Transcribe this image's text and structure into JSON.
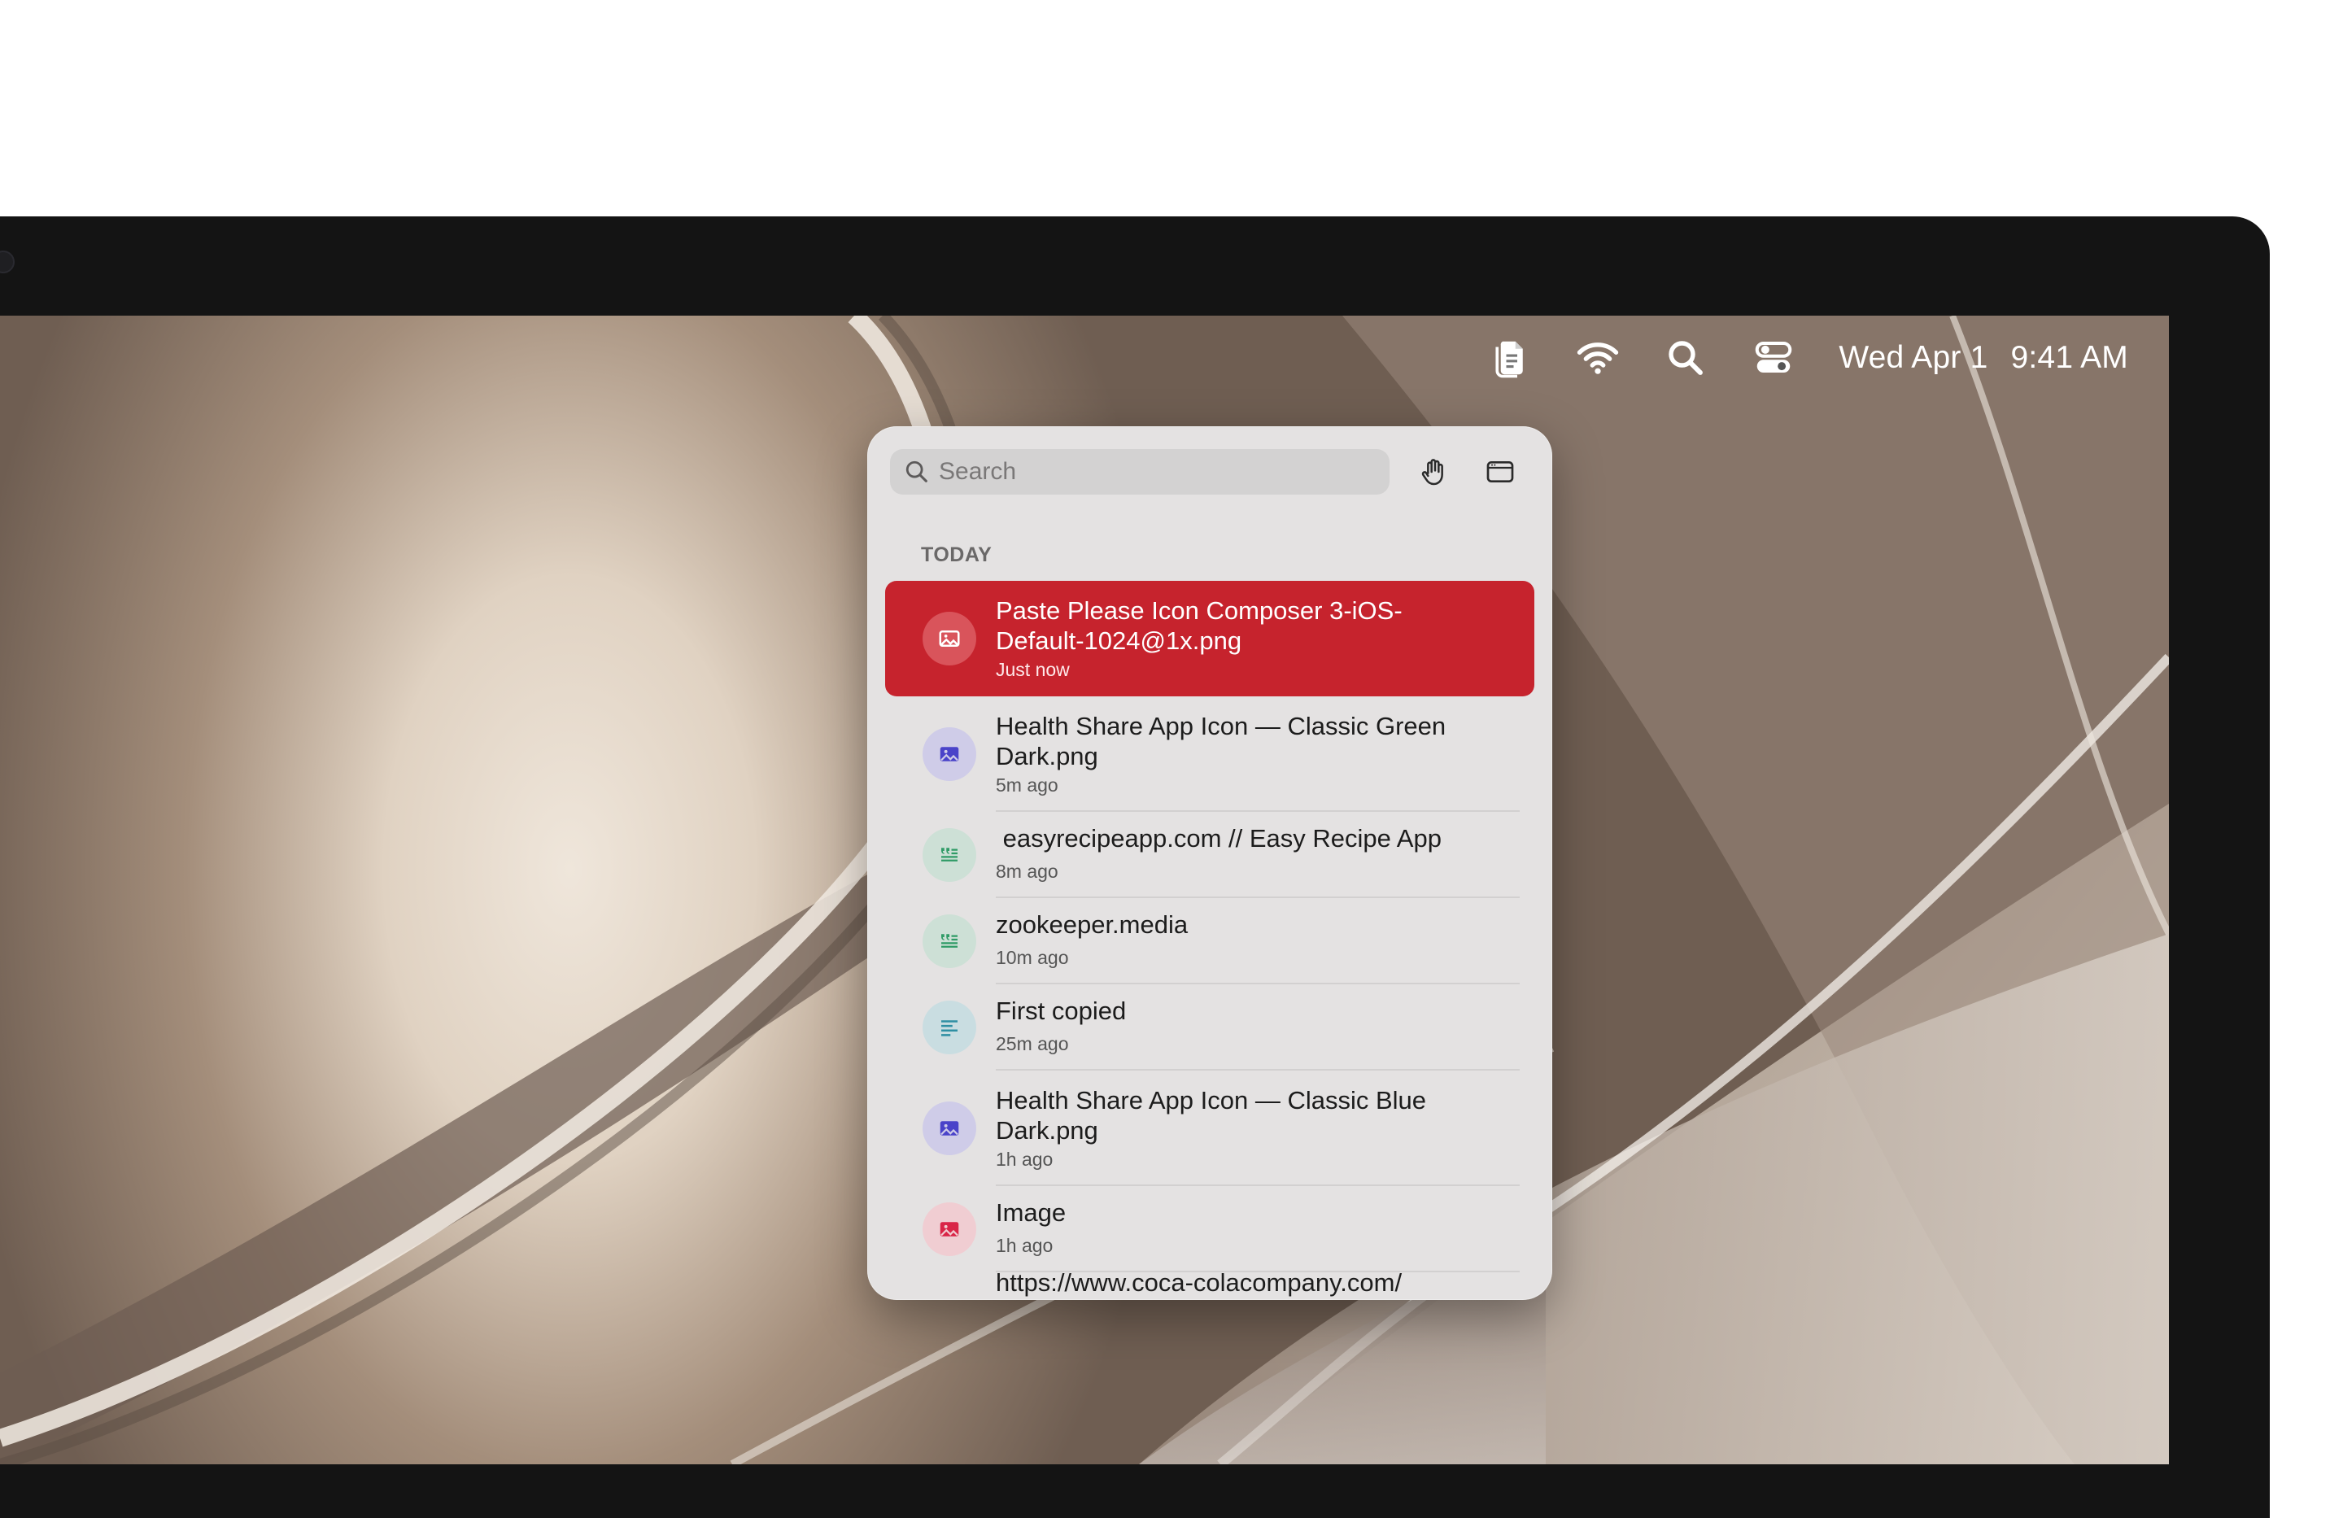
{
  "menubar": {
    "icons": [
      "clipboard-icon",
      "wifi-icon",
      "search-icon",
      "control-center-icon"
    ],
    "date": "Wed Apr 1",
    "time": "9:41 AM"
  },
  "panel": {
    "search_placeholder": "Search",
    "toolbar_icons": [
      "hand-icon",
      "window-icon"
    ],
    "section_label": "TODAY",
    "items": [
      {
        "title": "Paste Please Icon Composer 3-iOS-Default-1024@1x.png",
        "time": "Just now",
        "type": "image",
        "selected": true
      },
      {
        "title": "Health Share App Icon — Classic Green Dark.png",
        "time": "5m ago",
        "type": "image"
      },
      {
        "title": " easyrecipeapp.com // Easy Recipe App",
        "time": "8m ago",
        "type": "rich-text"
      },
      {
        "title": "zookeeper.media",
        "time": "10m ago",
        "type": "rich-text"
      },
      {
        "title": "First copied",
        "time": "25m ago",
        "type": "text"
      },
      {
        "title": "Health Share App Icon — Classic Blue Dark.png",
        "time": "1h ago",
        "type": "image"
      },
      {
        "title": "Image",
        "time": "1h ago",
        "type": "image-red"
      },
      {
        "title": "https://www.coca-colacompany.com/",
        "time": "",
        "type": "link"
      }
    ]
  },
  "colors": {
    "accent_selected": "#c6232d",
    "badge_purple": "#cfcce8",
    "badge_green": "#cde0d6",
    "badge_teal": "#c9dde1",
    "badge_red": "#f0cdd2"
  }
}
